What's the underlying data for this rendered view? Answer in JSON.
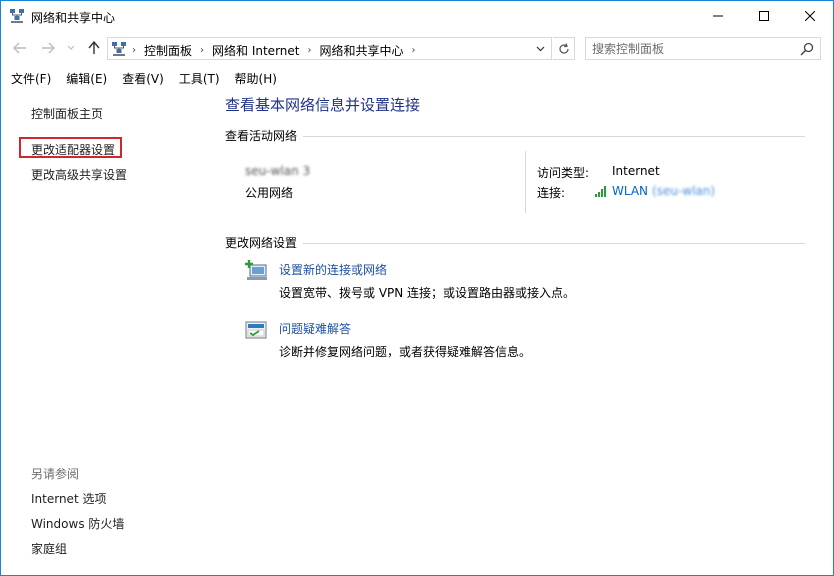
{
  "window": {
    "title": "网络和共享中心",
    "accent": "#1883d7"
  },
  "address": {
    "crumbs": [
      "控制面板",
      "网络和 Internet",
      "网络和共享中心"
    ],
    "search_placeholder": "搜索控制面板"
  },
  "menu": {
    "items": [
      "文件(F)",
      "编辑(E)",
      "查看(V)",
      "工具(T)",
      "帮助(H)"
    ]
  },
  "sidebar": {
    "home": "控制面板主页",
    "adapter": "更改适配器设置",
    "advanced": "更改高级共享设置",
    "see_also": "另请参阅",
    "internet_options": "Internet 选项",
    "firewall": "Windows 防火墙",
    "homegroup": "家庭组"
  },
  "main": {
    "title": "查看基本网络信息并设置连接",
    "active_heading": "查看活动网络",
    "network_name": "seu-wlan 3",
    "network_category": "公用网络",
    "access_type_label": "访问类型:",
    "access_type_value": "Internet",
    "connections_label": "连接:",
    "connection_name": "WLAN",
    "connection_ssid": "(seu-wlan)",
    "change_heading": "更改网络设置",
    "task1_link": "设置新的连接或网络",
    "task1_desc": "设置宽带、拨号或 VPN 连接；或设置路由器或接入点。",
    "task2_link": "问题疑难解答",
    "task2_desc": "诊断并修复网络问题，或者获得疑难解答信息。"
  },
  "colors": {
    "highlight_border": "#d0262c",
    "link": "#0066cc",
    "title": "#1e3287"
  }
}
